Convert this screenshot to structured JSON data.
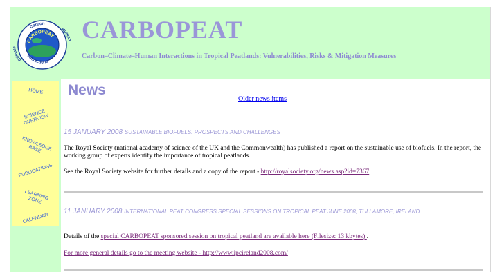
{
  "logo": {
    "ring_top": "Carbon",
    "ring_left": "Climate",
    "ring_right": "Human",
    "ring_bottom": "Interactions",
    "center": "CARBOPEAT"
  },
  "header": {
    "title": "CARBOPEAT",
    "subtitle": "Carbon–Climate–Human Interactions in Tropical Peatlands: Vulnerabilities, Risks & Mitigation Measures"
  },
  "nav": [
    {
      "label": "Home"
    },
    {
      "label": "Science\nOverview"
    },
    {
      "label": "Knowledge\nBase"
    },
    {
      "label": "Publications"
    },
    {
      "label": "Learning\nZone"
    },
    {
      "label": "Calendar"
    }
  ],
  "main": {
    "heading": "News",
    "older_link": "Older news items"
  },
  "news": [
    {
      "date": "15 JANUARY 2008",
      "title": "Sustainable Biofuels: Prospects and Challenges",
      "p1": "The Royal Society (national academy of science of the UK and the Commonwealth) has published a report on the sustainable use of biofuels. In the report, the working group of experts identify the importance of tropical peatlands.",
      "p2_prefix": "See the Royal Society website for further details and a copy of the report - ",
      "p2_link": "http://royalsociety.org/news.asp?id=7367",
      "p2_suffix": "."
    },
    {
      "date": "11 JANUARY 2008",
      "title": "International Peat Congress Special Sessions on Tropical Peat June 2008, Tullamore, Ireland",
      "p1_prefix": "Details of the ",
      "p1_link": "special CARBOPEAT sponsored session on tropical peatland are available here (Filesize: 13 kbytes) ",
      "p1_suffix": ".",
      "p2_link": "For more general details go to the meeting website - http://www.ipcireland2008.com/"
    }
  ],
  "colors": {
    "header_bg": "#ccffcc",
    "nav_bg": "#ffff99",
    "title": "#9a96d8",
    "nav_text": "#3b63d6",
    "link": "#7a2a7a"
  }
}
